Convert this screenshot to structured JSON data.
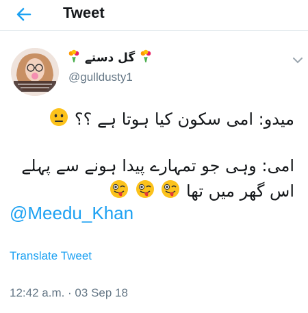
{
  "header": {
    "title": "Tweet"
  },
  "author": {
    "display_name": "گل دستے",
    "handle": "@gulldusty1"
  },
  "tweet": {
    "line1": "میدو: امی سکون کیا ہوتا ہے ؟؟",
    "line2": "امی: وہی جو تمہارے پیدا ہونے سے پہلے",
    "line3": "اس گھر میں تھا",
    "mention": "@Meedu_Khan"
  },
  "actions": {
    "translate_label": "Translate Tweet"
  },
  "meta": {
    "timestamp": "12:42 a.m. · 03 Sep 18"
  },
  "icons": {
    "back": "back-arrow-icon",
    "flower": "flower-bouquet-icon",
    "chevron": "chevron-down-icon",
    "neutral_face": "neutral-face-emoji",
    "winking_tongue": "winking-tongue-emoji"
  },
  "colors": {
    "accent": "#1da1f2",
    "muted": "#657786",
    "text": "#14171a"
  }
}
